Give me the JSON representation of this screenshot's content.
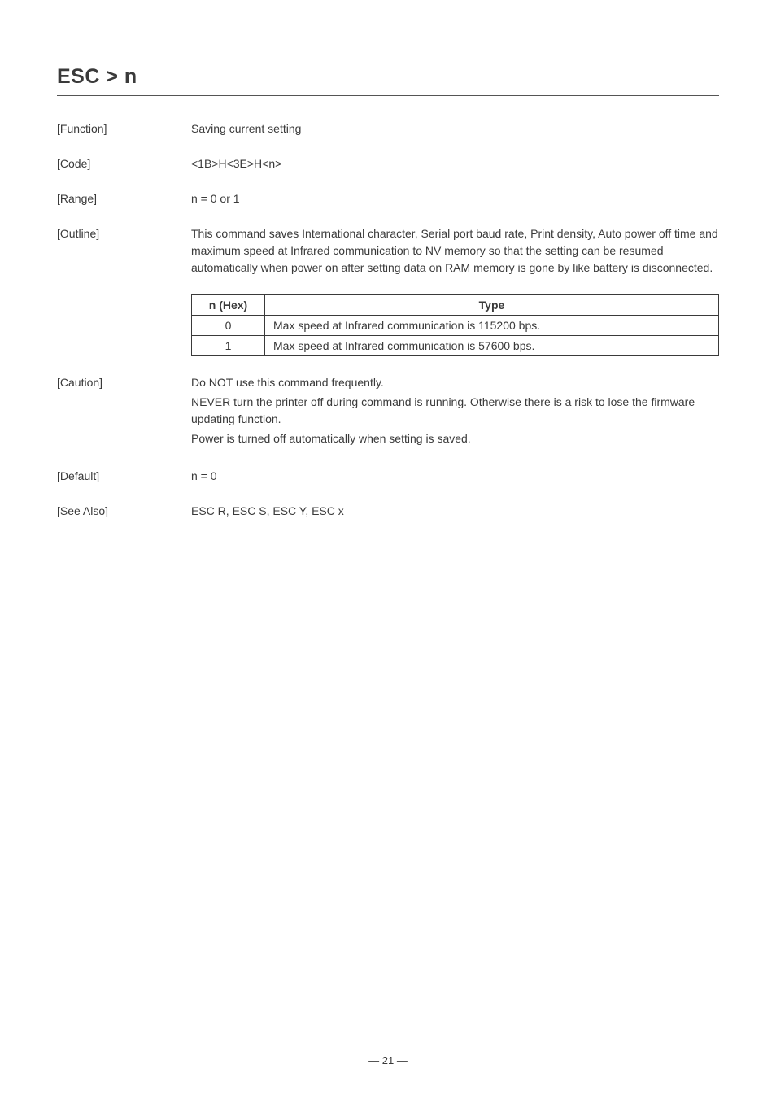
{
  "title": "ESC > n",
  "sections": {
    "function": {
      "label": "[Function]",
      "value": "Saving current setting"
    },
    "code": {
      "label": "[Code]",
      "value": "<1B>H<3E>H<n>"
    },
    "range": {
      "label": "[Range]",
      "value": "n = 0 or 1"
    },
    "outline": {
      "label": "[Outline]",
      "value": "This command saves International character, Serial port baud rate, Print density, Auto power off time and maximum speed at Infrared communication to NV memory so that the setting can be resumed automatically when power on after setting data on RAM memory is gone by like battery is disconnected."
    },
    "table": {
      "headers": {
        "col1": "n (Hex)",
        "col2": "Type"
      },
      "rows": [
        {
          "n": "0",
          "type": "Max speed at Infrared communication is 115200 bps."
        },
        {
          "n": "1",
          "type": "Max speed at Infrared communication is 57600 bps."
        }
      ]
    },
    "caution": {
      "label": "[Caution]",
      "lines": [
        "Do NOT use this command frequently.",
        "NEVER turn the printer off during command is running. Otherwise there is a risk to lose the firmware updating function.",
        "Power is turned off automatically when setting is saved."
      ]
    },
    "default": {
      "label": "[Default]",
      "value": "n = 0"
    },
    "seeAlso": {
      "label": "[See Also]",
      "value": "ESC R, ESC S, ESC Y, ESC x"
    }
  },
  "pageNumber": "— 21 —"
}
